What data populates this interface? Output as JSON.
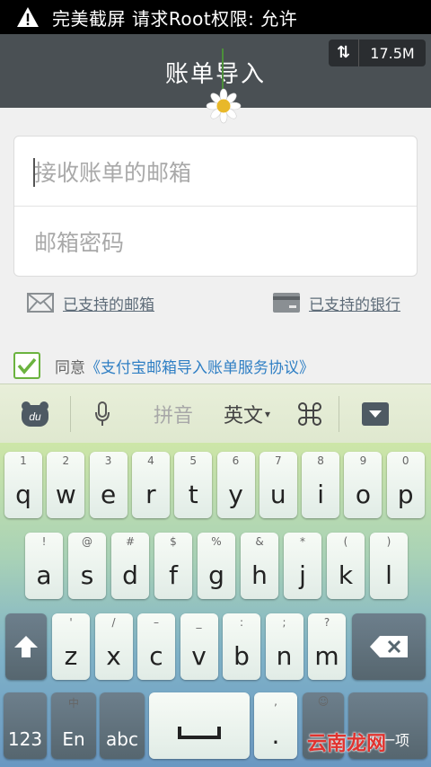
{
  "status_bar": {
    "message": "完美截屏 请求Root权限: 允许"
  },
  "header": {
    "title": "账单导入",
    "net_speed": "17.5M"
  },
  "form": {
    "email_placeholder": "接收账单的邮箱",
    "password_placeholder": "邮箱密码"
  },
  "links": {
    "supported_mail": "已支持的邮箱",
    "supported_bank": "已支持的银行"
  },
  "agreement": {
    "checked": true,
    "prefix": "同意",
    "link": "《支付宝邮箱导入账单服务协议》"
  },
  "keyboard_bar": {
    "logo": "du",
    "pinyin": "拼音",
    "english": "英文",
    "english_arrow": "▾"
  },
  "keyboard": {
    "row1": [
      {
        "main": "q",
        "sub": "1"
      },
      {
        "main": "w",
        "sub": "2"
      },
      {
        "main": "e",
        "sub": "3"
      },
      {
        "main": "r",
        "sub": "4"
      },
      {
        "main": "t",
        "sub": "5"
      },
      {
        "main": "y",
        "sub": "6"
      },
      {
        "main": "u",
        "sub": "7"
      },
      {
        "main": "i",
        "sub": "8"
      },
      {
        "main": "o",
        "sub": "9"
      },
      {
        "main": "p",
        "sub": "0"
      }
    ],
    "row2": [
      {
        "main": "a",
        "sub": "!"
      },
      {
        "main": "s",
        "sub": "@"
      },
      {
        "main": "d",
        "sub": "#"
      },
      {
        "main": "f",
        "sub": "$"
      },
      {
        "main": "g",
        "sub": "%"
      },
      {
        "main": "h",
        "sub": "&"
      },
      {
        "main": "j",
        "sub": "*"
      },
      {
        "main": "k",
        "sub": "("
      },
      {
        "main": "l",
        "sub": ")"
      }
    ],
    "row3": [
      {
        "main": "z",
        "sub": "'"
      },
      {
        "main": "x",
        "sub": "/"
      },
      {
        "main": "c",
        "sub": "–"
      },
      {
        "main": "v",
        "sub": "_"
      },
      {
        "main": "b",
        "sub": ":"
      },
      {
        "main": "n",
        "sub": ";"
      },
      {
        "main": "m",
        "sub": "?"
      }
    ],
    "num_label": "123",
    "lang_top": "中",
    "lang_label": "En",
    "abc_label": "abc",
    "period": ".",
    "period_sub": ",",
    "emoji_sub": "☺",
    "next_label": "下一项"
  },
  "watermark": "云南龙网",
  "colors": {
    "status_bg": "#000000",
    "titlebar_bg": "#4a5054",
    "link_blue": "#2f7fc4",
    "check_green": "#6bb33f"
  }
}
